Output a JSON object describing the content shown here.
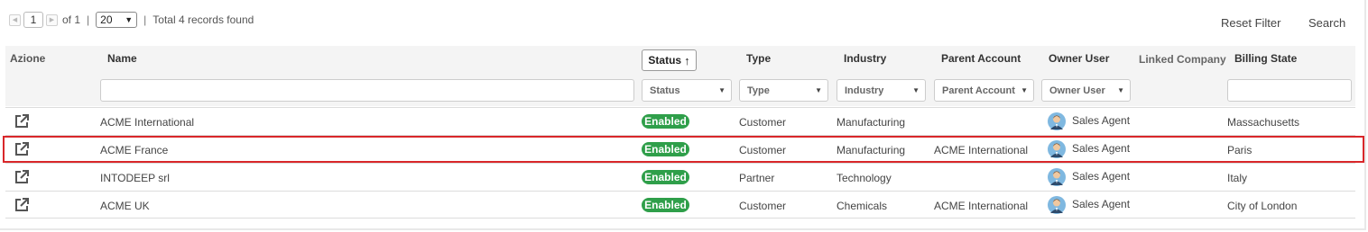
{
  "pager": {
    "current_page": "1",
    "of_label": "of 1",
    "separator": "|",
    "page_size": "20",
    "total_label": "Total 4 records found"
  },
  "toolbar": {
    "reset_filter": "Reset Filter",
    "search": "Search"
  },
  "columns": {
    "azione": "Azione",
    "name": "Name",
    "status": "Status",
    "type": "Type",
    "industry": "Industry",
    "parent_account": "Parent Account",
    "owner_user": "Owner User",
    "linked_company": "Linked Company",
    "billing_state": "Billing State"
  },
  "filters": {
    "status_placeholder": "Status",
    "type_placeholder": "Type",
    "industry_placeholder": "Industry",
    "parent_account_placeholder": "Parent Account",
    "owner_user_placeholder": "Owner User"
  },
  "rows": [
    {
      "name": "ACME International",
      "status": "Enabled",
      "type": "Customer",
      "industry": "Manufacturing",
      "parent_account": "",
      "owner": "Sales Agent",
      "linked_company": "",
      "billing_state": "Massachusetts"
    },
    {
      "name": "ACME France",
      "status": "Enabled",
      "type": "Customer",
      "industry": "Manufacturing",
      "parent_account": "ACME International",
      "owner": "Sales Agent",
      "linked_company": "",
      "billing_state": "Paris"
    },
    {
      "name": "INTODEEP srl",
      "status": "Enabled",
      "type": "Partner",
      "industry": "Technology",
      "parent_account": "",
      "owner": "Sales Agent",
      "linked_company": "",
      "billing_state": "Italy"
    },
    {
      "name": "ACME UK",
      "status": "Enabled",
      "type": "Customer",
      "industry": "Chemicals",
      "parent_account": "ACME International",
      "owner": "Sales Agent",
      "linked_company": "",
      "billing_state": "City of London"
    }
  ],
  "colors": {
    "enabled_badge": "#2f9f4a",
    "selection_outline": "#d9272a"
  },
  "icons": {
    "edit": "external-link-icon",
    "sort": "arrow-up-icon",
    "avatar": "user-avatar-icon"
  }
}
